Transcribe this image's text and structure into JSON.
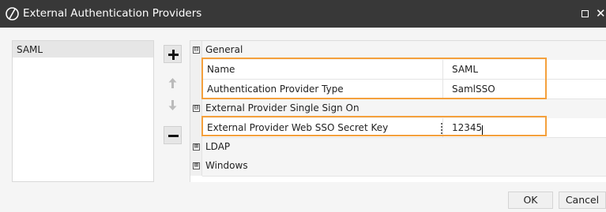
{
  "window": {
    "title": "External Authentication Providers"
  },
  "providers": {
    "items": [
      {
        "label": "SAML",
        "selected": true
      }
    ]
  },
  "toolbar": {
    "add_icon": "plus-icon",
    "up_icon": "arrow-up-icon",
    "down_icon": "arrow-down-icon",
    "remove_icon": "minus-icon"
  },
  "grid": {
    "general": {
      "label": "General",
      "expander": "⊟",
      "name_label": "Name",
      "name_value": "SAML",
      "type_label": "Authentication Provider Type",
      "type_value": "SamlSSO"
    },
    "sso": {
      "label": "External Provider Single Sign On",
      "expander": "⊟",
      "secret_label": "External Provider Web SSO Secret Key",
      "secret_value": "12345"
    },
    "ldap": {
      "label": "LDAP",
      "expander": "⊞"
    },
    "windows": {
      "label": "Windows",
      "expander": "⊞"
    }
  },
  "buttons": {
    "ok": "OK",
    "cancel": "Cancel"
  },
  "colors": {
    "titlebar": "#383838",
    "highlight": "#f4a03c",
    "selected_item": "#e6e6e6"
  }
}
